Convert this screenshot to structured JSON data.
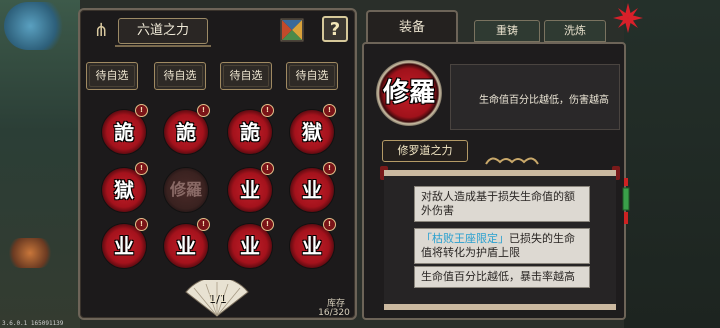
{
  "colors": {
    "accent_red": "#b3141e",
    "panel_bg": "#1c1a1b",
    "frame": "#6d6458",
    "highlight_cyan": "#2aa0d0"
  },
  "left_panel": {
    "title": "六道之力",
    "icons": {
      "tuning": "tuning-fork-icon",
      "palette": "color-palette-icon",
      "help": "?"
    },
    "slot_buttons": [
      "待自选",
      "待自选",
      "待自选",
      "待自选"
    ],
    "runes": [
      {
        "glyph": "詭",
        "badge": "!",
        "state": "active"
      },
      {
        "glyph": "詭",
        "badge": "!",
        "state": "active"
      },
      {
        "glyph": "詭",
        "badge": "!",
        "state": "active"
      },
      {
        "glyph": "獄",
        "badge": "!",
        "state": "active"
      },
      {
        "glyph": "獄",
        "badge": "!",
        "state": "active"
      },
      {
        "glyph": "修羅",
        "badge": "",
        "state": "dim"
      },
      {
        "glyph": "业",
        "badge": "!",
        "state": "active"
      },
      {
        "glyph": "业",
        "badge": "!",
        "state": "active"
      },
      {
        "glyph": "业",
        "badge": "!",
        "state": "active"
      },
      {
        "glyph": "业",
        "badge": "!",
        "state": "active"
      },
      {
        "glyph": "业",
        "badge": "!",
        "state": "active"
      },
      {
        "glyph": "业",
        "badge": "!",
        "state": "active"
      }
    ],
    "page": "1/1",
    "stock_label": "库存",
    "stock_value": "16/320"
  },
  "right_panel": {
    "tabs": {
      "equip": "装备",
      "recast": "重铸",
      "wash": "洗炼"
    },
    "hero": {
      "glyph": "修羅",
      "name": "修罗道之力",
      "description": "生命值百分比越低，伤害越高"
    },
    "effects": [
      {
        "prefix": "",
        "highlight": "",
        "text": "对敌人造成基于损失生命值的额外伤害"
      },
      {
        "prefix": "",
        "highlight": "「枯败王座限定」",
        "text": "已损失的生命值将转化为护盾上限"
      },
      {
        "prefix": "",
        "highlight": "",
        "text": "生命值百分比越低，暴击率越高"
      }
    ]
  },
  "version": "3.6.0.1 165091139"
}
